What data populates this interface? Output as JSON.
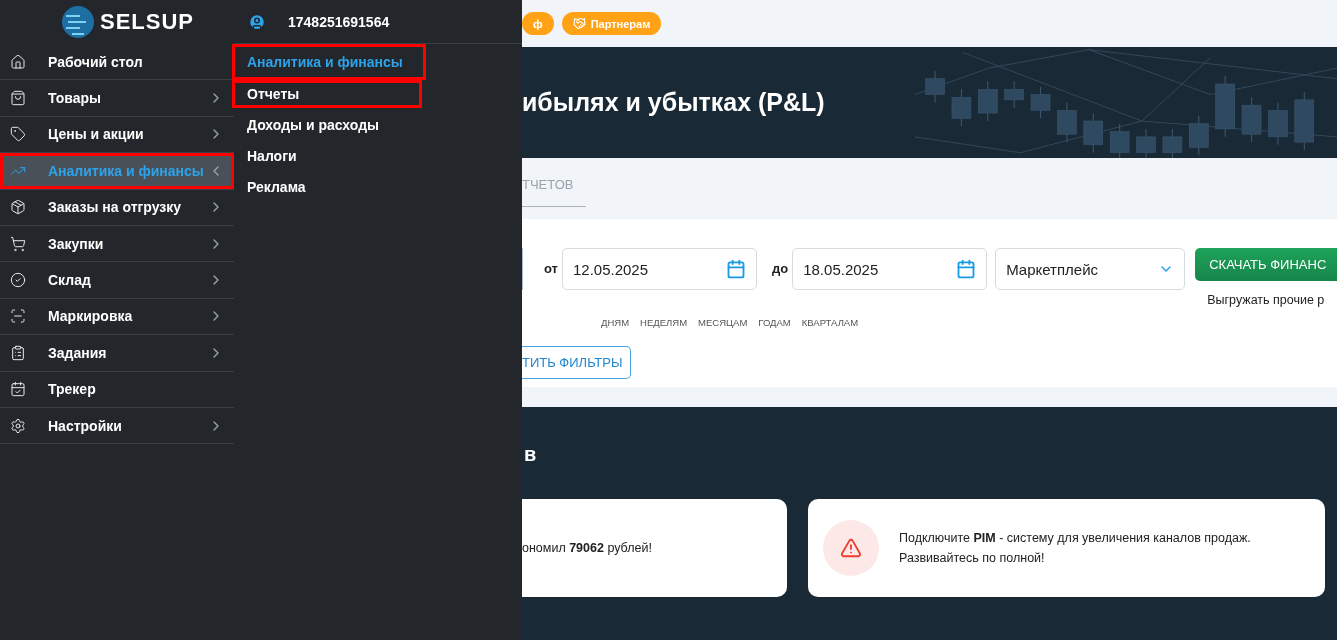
{
  "sidebar": {
    "logo": "SELSUP",
    "items": [
      {
        "label": "Рабочий стол",
        "expandable": false,
        "selected": false,
        "highlighted": false
      },
      {
        "label": "Товары",
        "expandable": true,
        "selected": false,
        "highlighted": false
      },
      {
        "label": "Цены и акции",
        "expandable": true,
        "selected": false,
        "highlighted": false
      },
      {
        "label": "Аналитика и финансы",
        "expandable": true,
        "selected": true,
        "highlighted": true
      },
      {
        "label": "Заказы на отгрузку",
        "expandable": true,
        "selected": false,
        "highlighted": false
      },
      {
        "label": "Закупки",
        "expandable": true,
        "selected": false,
        "highlighted": false
      },
      {
        "label": "Склад",
        "expandable": true,
        "selected": false,
        "highlighted": false
      },
      {
        "label": "Маркировка",
        "expandable": true,
        "selected": false,
        "highlighted": false
      },
      {
        "label": "Задания",
        "expandable": true,
        "selected": false,
        "highlighted": false
      },
      {
        "label": "Трекер",
        "expandable": false,
        "selected": false,
        "highlighted": false
      },
      {
        "label": "Настройки",
        "expandable": true,
        "selected": false,
        "highlighted": false
      }
    ]
  },
  "submenu": {
    "account": "1748251691564",
    "title": {
      "label": "Аналитика и финансы",
      "highlighted": true
    },
    "items": [
      {
        "label": "Отчеты",
        "highlighted": true
      },
      {
        "label": "Доходы и расходы",
        "highlighted": false
      },
      {
        "label": "Налоги",
        "highlighted": false
      },
      {
        "label": "Реклама",
        "highlighted": false
      }
    ]
  },
  "top_badges": [
    "ф",
    "Партнерам"
  ],
  "banner": {
    "title": "ибылях и убытках (P&L)"
  },
  "tab": {
    "label": "ТЧЕТОВ"
  },
  "filters": {
    "from_label": "от",
    "from_date": "12.05.2025",
    "to_label": "до",
    "to_date": "18.05.2025",
    "marketplace": "Маркетплейс",
    "periods": [
      "ДНЯМ",
      "НЕДЕЛЯМ",
      "МЕСЯЦАМ",
      "ГОДАМ",
      "КВАРТАЛАМ"
    ],
    "download_button": "СКАЧАТЬ ФИНАНС",
    "download_note": "Выгружать прочие р",
    "reset_button": "ТИТЬ ФИЛЬТРЫ"
  },
  "tips": {
    "heading": "в",
    "cards": [
      {
        "kind": "plain",
        "lines": [
          "ономил **79062** рублей!"
        ]
      },
      {
        "kind": "warning",
        "lines": [
          "Подключите **PIM** - систему для увеличения каналов продаж.",
          "Развивайтесь по полной!"
        ]
      }
    ]
  }
}
